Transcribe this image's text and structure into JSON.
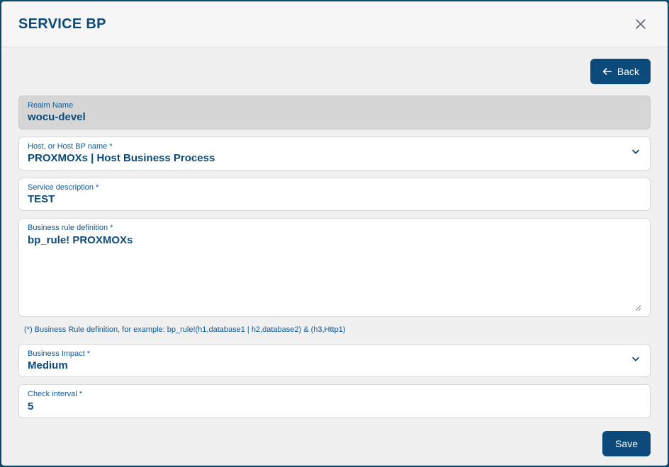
{
  "header": {
    "title": "SERVICE BP"
  },
  "toolbar": {
    "back_label": "Back"
  },
  "form": {
    "realm": {
      "label": "Realm Name",
      "value": "wocu-devel"
    },
    "host": {
      "label": "Host, or Host BP name *",
      "value": "PROXMOXs | Host Business Process"
    },
    "service_description": {
      "label": "Service description *",
      "value": "TEST"
    },
    "business_rule": {
      "label": "Business rule definition *",
      "value": "bp_rule! PROXMOXs"
    },
    "business_rule_hint": "(*) Business Rule definition, for example: bp_rule!(h1,database1 | h2,database2) & (h3,Http1)",
    "business_impact": {
      "label": "Business Impact *",
      "value": "Medium"
    },
    "check_interval": {
      "label": "Check interval *",
      "value": "5"
    }
  },
  "footer": {
    "save_label": "Save"
  }
}
